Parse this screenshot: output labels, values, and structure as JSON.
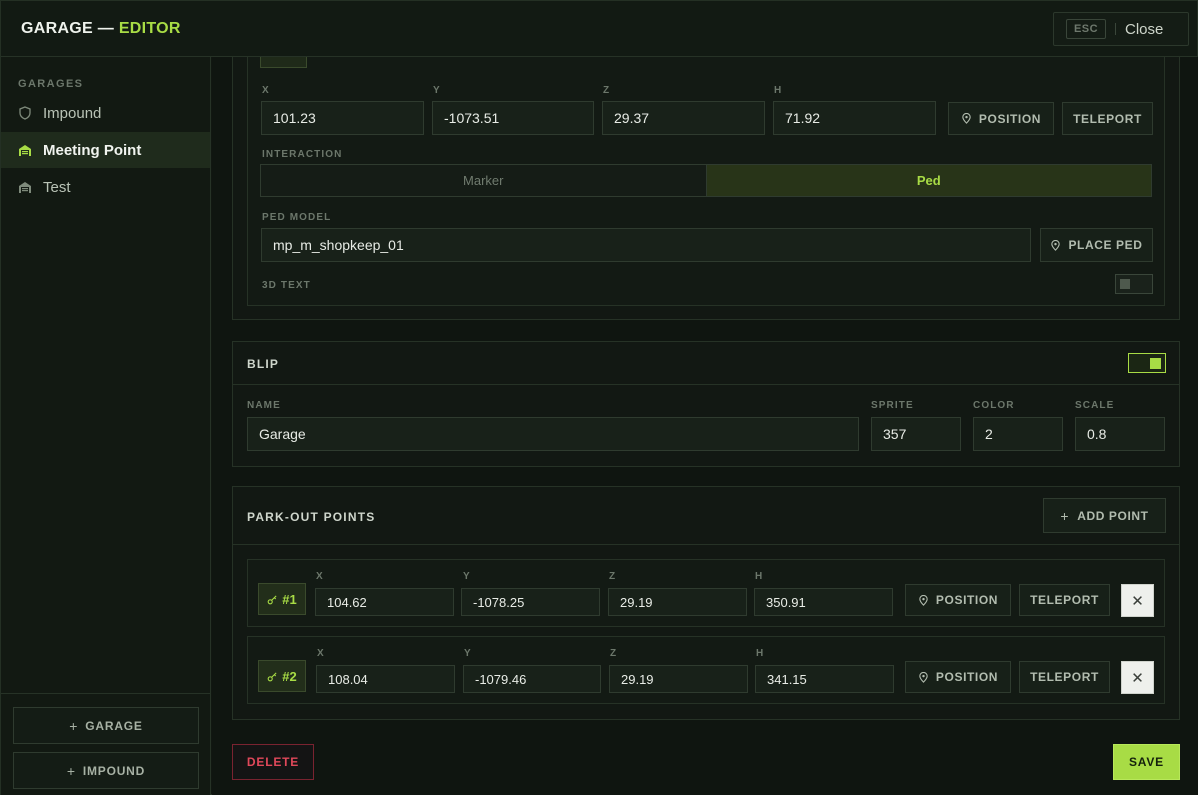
{
  "header": {
    "title_prefix": "GARAGE —",
    "title_accent": "EDITOR",
    "esc_label": "ESC",
    "close_label": "Close"
  },
  "sidebar": {
    "section_label": "GARAGES",
    "items": [
      {
        "label": "Impound",
        "icon": "shield-icon"
      },
      {
        "label": "Meeting Point",
        "icon": "garage-icon"
      },
      {
        "label": "Test",
        "icon": "garage-icon"
      }
    ],
    "active_index": 1,
    "add_garage_label": "GARAGE",
    "add_impound_label": "IMPOUND"
  },
  "interaction_section": {
    "coords": {
      "x_label": "X",
      "x_value": "101.23",
      "y_label": "Y",
      "y_value": "-1073.51",
      "z_label": "Z",
      "z_value": "29.37",
      "h_label": "H",
      "h_value": "71.92"
    },
    "position_label": "POSITION",
    "teleport_label": "TELEPORT",
    "interaction_label": "INTERACTION",
    "interaction_options": [
      "Marker",
      "Ped"
    ],
    "interaction_selected": "Ped",
    "ped_model_label": "PED MODEL",
    "ped_model_value": "mp_m_shopkeep_01",
    "place_ped_label": "PLACE PED",
    "text3d_label": "3D TEXT",
    "text3d_enabled": false
  },
  "blip": {
    "title": "BLIP",
    "enabled": true,
    "name_label": "NAME",
    "name_value": "Garage",
    "sprite_label": "SPRITE",
    "sprite_value": "357",
    "color_label": "COLOR",
    "color_value": "2",
    "scale_label": "SCALE",
    "scale_value": "0.8"
  },
  "park_out": {
    "title": "PARK-OUT POINTS",
    "add_point_label": "ADD POINT",
    "points": [
      {
        "tag": "#1",
        "x": "104.62",
        "y": "-1078.25",
        "z": "29.19",
        "h": "350.91"
      },
      {
        "tag": "#2",
        "x": "108.04",
        "y": "-1079.46",
        "z": "29.19",
        "h": "341.15"
      }
    ],
    "coord_labels": {
      "x": "X",
      "y": "Y",
      "z": "Z",
      "h": "H"
    },
    "position_label": "POSITION",
    "teleport_label": "TELEPORT",
    "remove_glyph": "✕"
  },
  "footer": {
    "delete_label": "DELETE",
    "save_label": "SAVE"
  },
  "colors": {
    "accent": "#a8dc45",
    "danger": "#e0485a",
    "background": "#111711"
  }
}
